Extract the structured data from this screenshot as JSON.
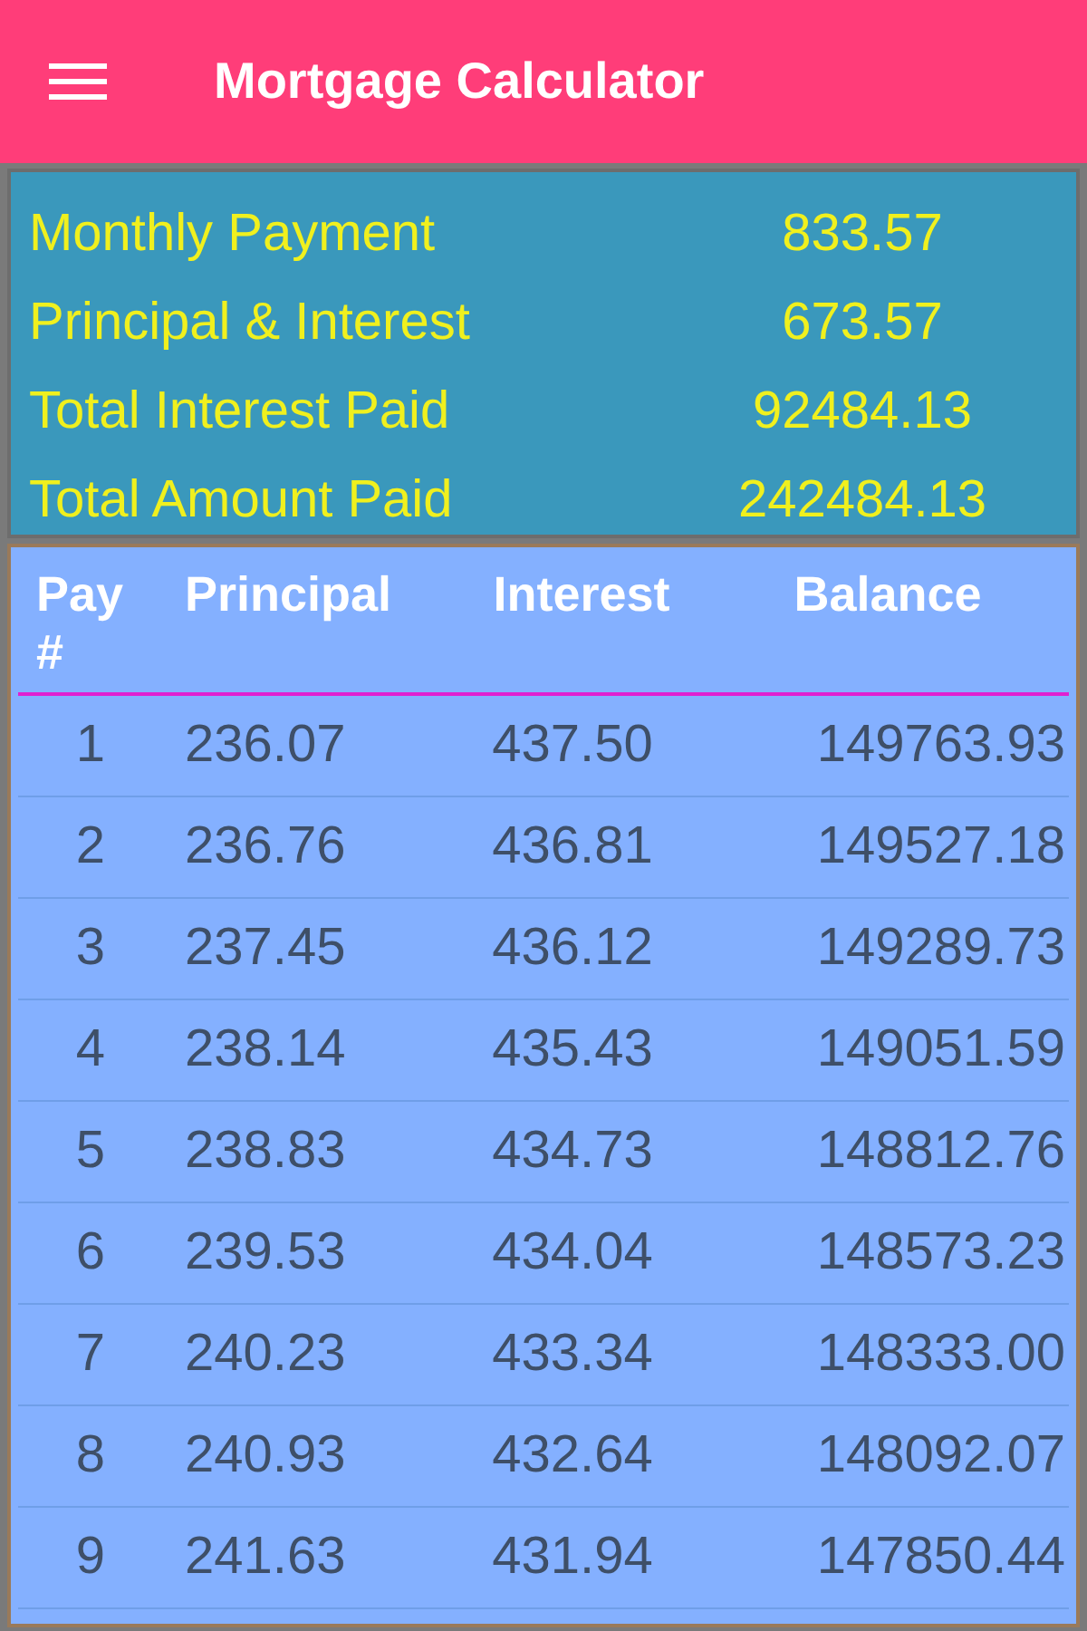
{
  "app_bar": {
    "title": "Mortgage Calculator"
  },
  "summary": [
    {
      "label": "Monthly Payment",
      "value": "833.57"
    },
    {
      "label": "Principal & Interest",
      "value": "673.57"
    },
    {
      "label": "Total Interest Paid",
      "value": "92484.13"
    },
    {
      "label": "Total Amount Paid",
      "value": "242484.13"
    }
  ],
  "table": {
    "columns": [
      "Pay #",
      "Principal",
      "Interest",
      "Balance"
    ],
    "rows": [
      [
        "1",
        "236.07",
        "437.50",
        "149763.93"
      ],
      [
        "2",
        "236.76",
        "436.81",
        "149527.18"
      ],
      [
        "3",
        "237.45",
        "436.12",
        "149289.73"
      ],
      [
        "4",
        "238.14",
        "435.43",
        "149051.59"
      ],
      [
        "5",
        "238.83",
        "434.73",
        "148812.76"
      ],
      [
        "6",
        "239.53",
        "434.04",
        "148573.23"
      ],
      [
        "7",
        "240.23",
        "433.34",
        "148333.00"
      ],
      [
        "8",
        "240.93",
        "432.64",
        "148092.07"
      ],
      [
        "9",
        "241.63",
        "431.94",
        "147850.44"
      ]
    ]
  }
}
